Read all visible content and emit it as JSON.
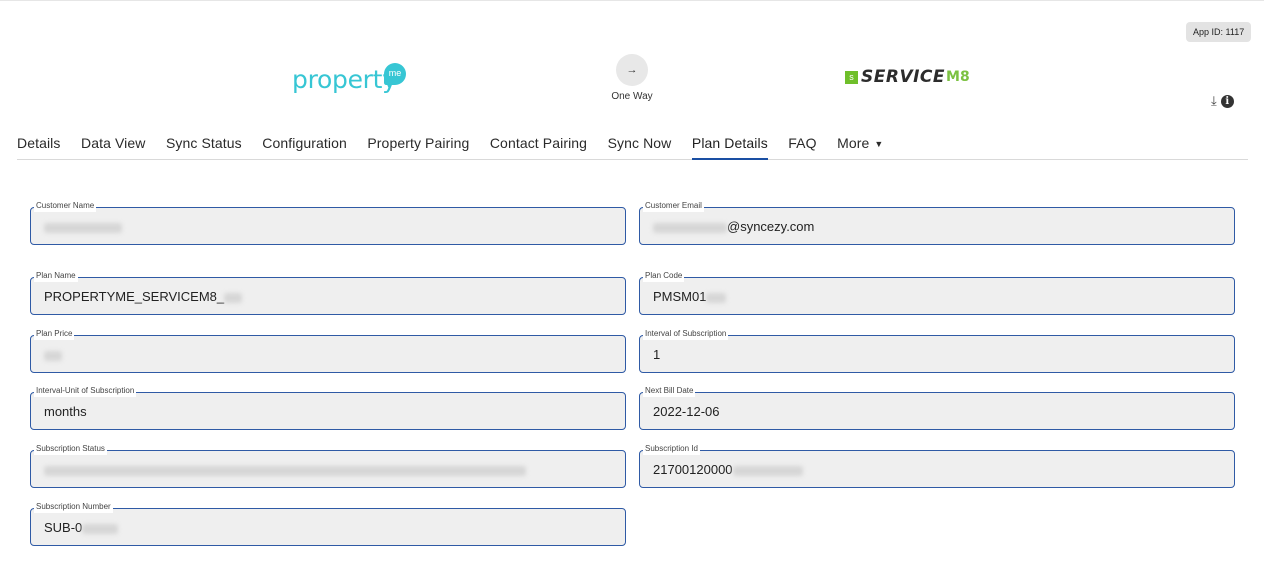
{
  "app_id": "App ID: 1117",
  "logos": {
    "left": {
      "text": "property",
      "badge": "me"
    },
    "right": {
      "icon": "s",
      "text": "SERVICE",
      "suffix": "M8"
    }
  },
  "sync_direction": {
    "icon": "arrow-right-icon",
    "glyph": "→",
    "label": "One Way"
  },
  "header_icons": {
    "download_glyph": "⤓",
    "info_glyph": "i"
  },
  "tabs": [
    {
      "label": "Details"
    },
    {
      "label": "Data View"
    },
    {
      "label": "Sync Status"
    },
    {
      "label": "Configuration"
    },
    {
      "label": "Property Pairing"
    },
    {
      "label": "Contact Pairing"
    },
    {
      "label": "Sync Now"
    },
    {
      "label": "Plan Details",
      "active": true
    },
    {
      "label": "FAQ"
    },
    {
      "label": "More",
      "caret": "▼"
    }
  ],
  "fields": {
    "customer_name": {
      "label": "Customer Name",
      "value": ""
    },
    "customer_email": {
      "label": "Customer Email",
      "value": "@syncezy.com"
    },
    "plan_name": {
      "label": "Plan Name",
      "value": "PROPERTYME_SERVICEM8_"
    },
    "plan_code": {
      "label": "Plan Code",
      "value": "PMSM01"
    },
    "plan_price": {
      "label": "Plan Price",
      "value": ""
    },
    "interval": {
      "label": "Interval of Subscription",
      "value": "1"
    },
    "interval_unit": {
      "label": "Interval-Unit of Subscription",
      "value": "months"
    },
    "next_bill_date": {
      "label": "Next Bill Date",
      "value": "2022-12-06"
    },
    "subscription_status": {
      "label": "Subscription Status",
      "value": ""
    },
    "subscription_id": {
      "label": "Subscription Id",
      "value": "21700120000"
    },
    "subscription_number": {
      "label": "Subscription Number",
      "value": "SUB-0"
    }
  },
  "colors": {
    "accent": "#1a4fa3",
    "field_border": "#2f5aa5",
    "field_bg": "#efefef",
    "propertyme_brand": "#37c6d4",
    "servicem8_brand": "#7cc242"
  }
}
